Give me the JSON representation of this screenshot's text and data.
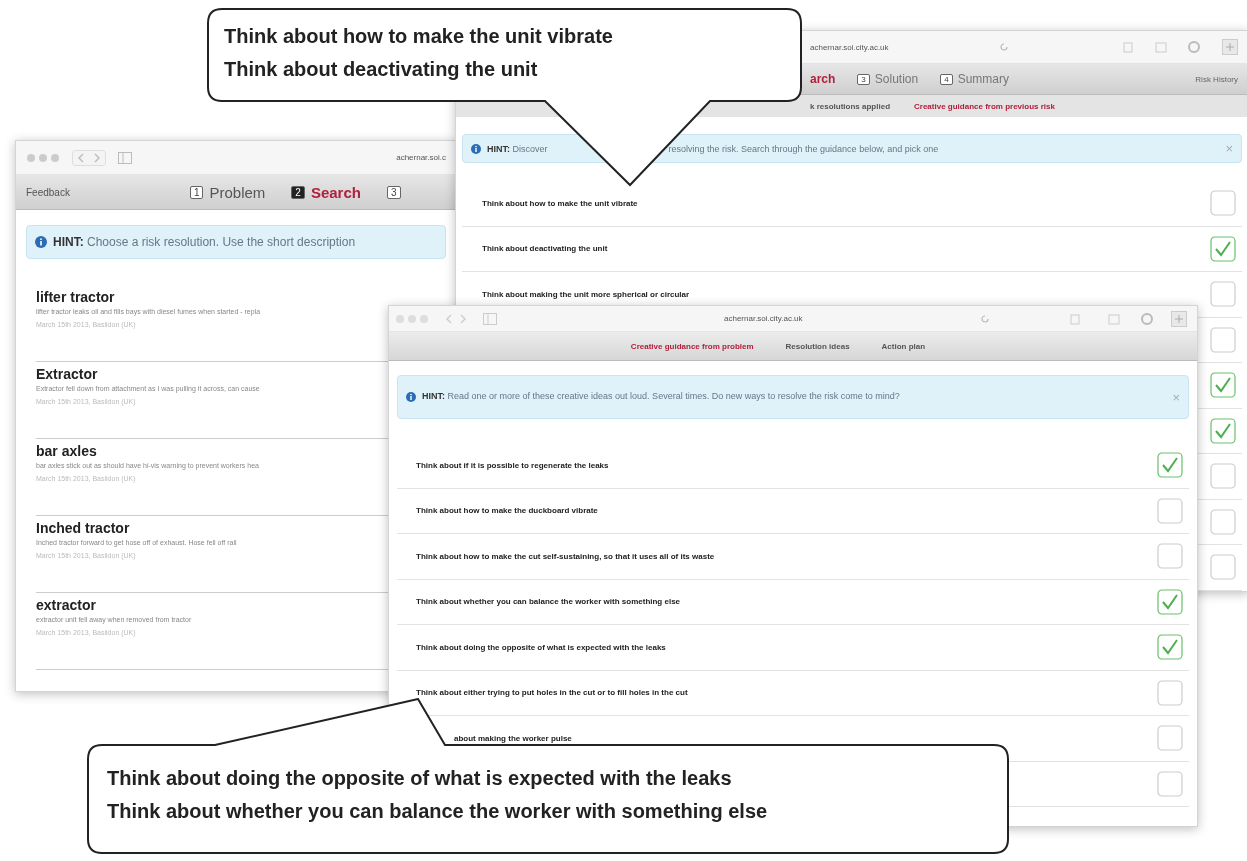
{
  "left_window": {
    "url": "achernar.soi.c",
    "toolbar_link": "Feedback",
    "tabs": [
      {
        "number": "1",
        "label": "Problem",
        "selected": false
      },
      {
        "number": "2",
        "label": "Search",
        "selected": true
      },
      {
        "number": "3",
        "selected": false
      }
    ],
    "hint": {
      "label": "HINT:",
      "text": "Choose a risk resolution. Use the short description"
    },
    "risks": [
      {
        "title": "lifter tractor",
        "description": "lifter tractor leaks oil and fills bays with diesel fumes when started - repla",
        "meta": "March 15th 2013, Basildon (UK)"
      },
      {
        "title": "Extractor",
        "description": "Extractor fell down from attachment as I was pulling it across, can cause",
        "meta": "March 15th 2013, Basildon (UK)"
      },
      {
        "title": "bar axles",
        "description": "bar axles stick out as should have hi-vis warning to prevent workers hea",
        "meta": "March 15th 2013, Basildon (UK)"
      },
      {
        "title": "Inched tractor",
        "description": "Inched tractor forward to get hose off of exhaust. Hose fell off rail",
        "meta": "March 15th 2013, Basildon (UK)"
      },
      {
        "title": "extractor",
        "description": "extractor unit fell away when removed from tractor",
        "meta": "March 15th 2013, Basildon (UK)"
      }
    ]
  },
  "back_window": {
    "url": "achernar.soi.city.ac.uk",
    "tabs": [
      {
        "label": "arch",
        "selected": true
      },
      {
        "number": "3",
        "label": "Solution",
        "selected": false
      },
      {
        "number": "4",
        "label": "Summary",
        "selected": false
      }
    ],
    "side_link": "Risk History",
    "subtabs": [
      {
        "label": "k resolutions applied",
        "selected": false
      },
      {
        "label": "Creative guidance from previous risk",
        "selected": true
      }
    ],
    "hint": {
      "label": "HINT:",
      "text_before": "Discover",
      "text_after": "resolving the risk. Search through the guidance below, and pick one",
      "close": "×"
    },
    "guidance": [
      {
        "text": "Think about how to make the unit vibrate",
        "checked": false
      },
      {
        "text": "Think about deactivating the unit",
        "checked": true
      },
      {
        "text": "Think about making the unit more spherical or circular",
        "checked": false
      },
      {
        "checked": false
      },
      {
        "checked": true
      },
      {
        "checked": true
      },
      {
        "checked": false
      },
      {
        "checked": false
      },
      {
        "checked": false
      }
    ]
  },
  "front_window": {
    "url": "achernar.soi.city.ac.uk",
    "subtabs": [
      {
        "label": "Creative guidance from problem",
        "selected": true
      },
      {
        "label": "Resolution ideas",
        "selected": false
      },
      {
        "label": "Action plan",
        "selected": false
      }
    ],
    "hint": {
      "label": "HINT:",
      "text": "Read one or more of these creative ideas out loud. Several times. Do new ways to resolve the risk come to mind?",
      "close": "×"
    },
    "ideas": [
      {
        "text": "Think about if it is possible to regenerate the leaks",
        "checked": true
      },
      {
        "text": "Think about how to make the duckboard vibrate",
        "checked": false
      },
      {
        "text": "Think about how to make the cut self-sustaining, so that it uses all of its waste",
        "checked": false
      },
      {
        "text": "Think about whether you can balance the worker with something else",
        "checked": true
      },
      {
        "text": "Think about doing the opposite of what is expected with the leaks",
        "checked": true
      },
      {
        "text": "Think about either trying to put holes in the cut or to fill holes in the cut",
        "checked": false
      },
      {
        "text": "about making the worker pulse",
        "checked": false
      },
      {
        "checked": false
      }
    ]
  },
  "callouts": [
    {
      "lines": [
        "Think about how to make the unit vibrate",
        "Think about deactivating the unit"
      ]
    },
    {
      "lines": [
        "Think about doing the opposite of what is expected with the leaks",
        "Think about whether you can balance the worker with something else"
      ]
    }
  ]
}
